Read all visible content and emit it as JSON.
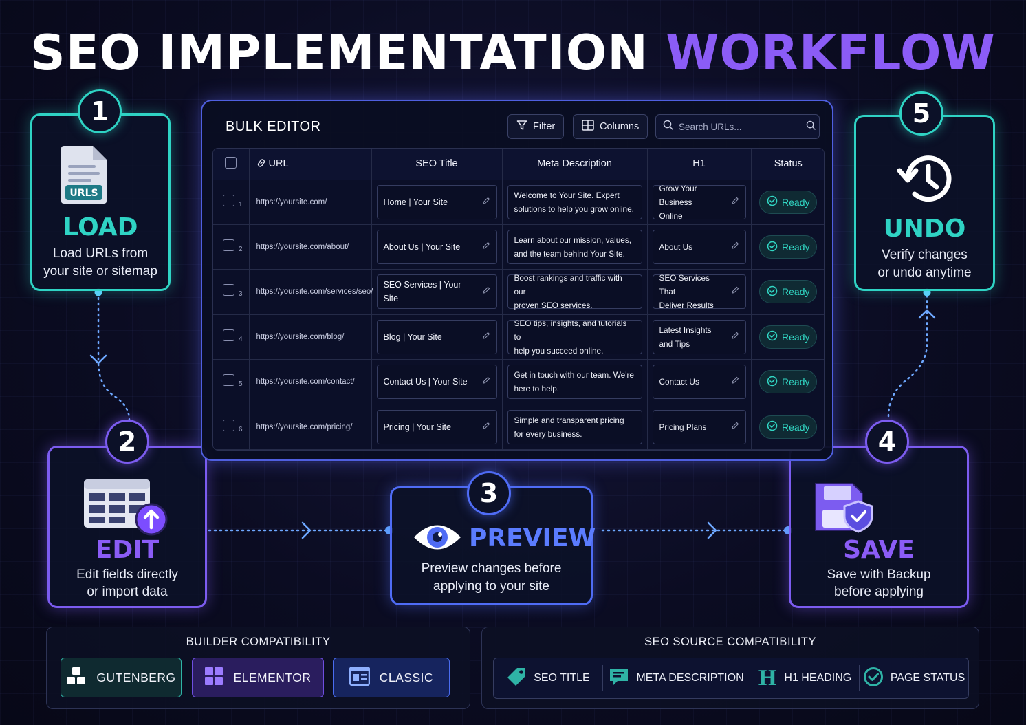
{
  "title": {
    "main": "SEO IMPLEMENTATION",
    "accent": "WORKFLOW"
  },
  "steps": [
    {
      "number": "1",
      "title": "LOAD",
      "desc1": "Load URLs from",
      "desc2": "your site or sitemap",
      "icon": "urls-file-icon",
      "icon_label": "URLS"
    },
    {
      "number": "2",
      "title": "EDIT",
      "desc1": "Edit fields directly",
      "desc2": "or import data",
      "icon": "table-upload-icon"
    },
    {
      "number": "3",
      "title": "PREVIEW",
      "desc1": "Preview changes before",
      "desc2": "applying to your site",
      "icon": "eye-icon"
    },
    {
      "number": "4",
      "title": "SAVE",
      "desc1": "Save with Backup",
      "desc2": "before applying",
      "icon": "save-shield-icon"
    },
    {
      "number": "5",
      "title": "UNDO",
      "desc1": "Verify changes",
      "desc2": "or undo anytime",
      "icon": "history-icon"
    }
  ],
  "editor": {
    "title": "BULK EDITOR",
    "filter_label": "Filter",
    "columns_label": "Columns",
    "search_placeholder": "Search URLs...",
    "headers": {
      "url": "URL",
      "seo_title": "SEO Title",
      "meta": "Meta Description",
      "h1": "H1",
      "status": "Status"
    },
    "rows": [
      {
        "num": "1",
        "url": "https://yoursite.com/",
        "seo_title": "Home | Your Site",
        "meta1": "Welcome to Your Site. Expert",
        "meta2": "solutions to help you grow online.",
        "h1a": "Grow Your Business",
        "h1b": "Online",
        "status": "Ready"
      },
      {
        "num": "2",
        "url": "https://yoursite.com/about/",
        "seo_title": "About Us | Your Site",
        "meta1": "Learn about our mission, values,",
        "meta2": "and the team behind Your Site.",
        "h1a": "About Us",
        "h1b": "",
        "status": "Ready"
      },
      {
        "num": "3",
        "url": "https://yoursite.com/services/seo/",
        "seo_title": "SEO Services | Your Site",
        "meta1": "Boost rankings and traffic with our",
        "meta2": "proven SEO services.",
        "h1a": "SEO Services That",
        "h1b": "Deliver Results",
        "status": "Ready"
      },
      {
        "num": "4",
        "url": "https://yoursite.com/blog/",
        "seo_title": "Blog | Your Site",
        "meta1": "SEO tips, insights, and tutorials to",
        "meta2": "help you succeed online.",
        "h1a": "Latest Insights",
        "h1b": "and Tips",
        "status": "Ready"
      },
      {
        "num": "5",
        "url": "https://yoursite.com/contact/",
        "seo_title": "Contact Us | Your Site",
        "meta1": "Get in touch with our team. We're",
        "meta2": "here to help.",
        "h1a": "Contact Us",
        "h1b": "",
        "status": "Ready"
      },
      {
        "num": "6",
        "url": "https://yoursite.com/pricing/",
        "seo_title": "Pricing | Your Site",
        "meta1": "Simple and transparent pricing",
        "meta2": "for every business.",
        "h1a": "Pricing Plans",
        "h1b": "",
        "status": "Ready"
      }
    ]
  },
  "builder": {
    "title": "BUILDER COMPATIBILITY",
    "items": [
      {
        "label": "GUTENBERG",
        "icon": "blocks-icon"
      },
      {
        "label": "ELEMENTOR",
        "icon": "elementor-icon"
      },
      {
        "label": "CLASSIC",
        "icon": "classic-editor-icon"
      }
    ]
  },
  "sources": {
    "title": "SEO SOURCE COMPATIBILITY",
    "items": [
      {
        "label": "SEO TITLE",
        "icon": "tag-icon"
      },
      {
        "label": "META DESCRIPTION",
        "icon": "chat-icon"
      },
      {
        "label": "H1 HEADING",
        "icon": "h-icon",
        "glyph": "H"
      },
      {
        "label": "PAGE STATUS",
        "icon": "check-circle-icon"
      }
    ]
  },
  "colors": {
    "teal": "#2fd3c4",
    "violet": "#7c5cf0",
    "blue": "#4f6cf5",
    "accent_purple": "#8b5cf6"
  }
}
